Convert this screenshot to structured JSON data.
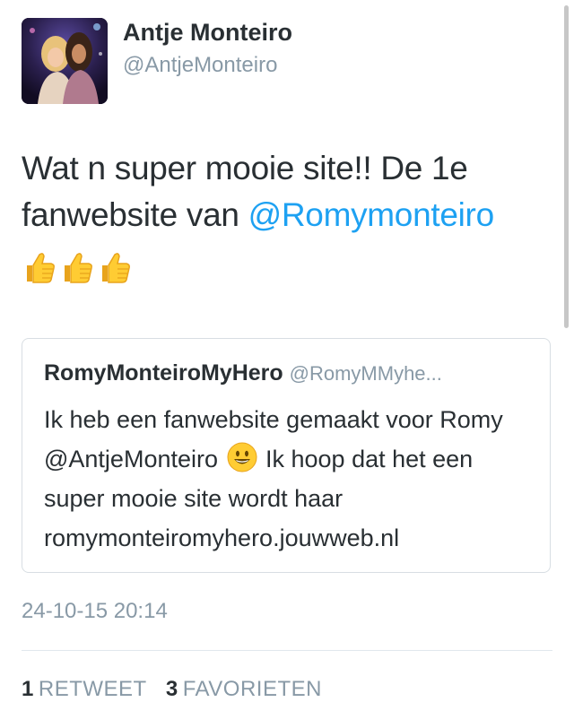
{
  "author": {
    "name": "Antje Monteiro",
    "handle": "@AntjeMonteiro"
  },
  "tweet": {
    "text_part1": "Wat n super mooie site!! De 1e fanwebsite van ",
    "mention": "@Romymonteiro",
    "emoji_icon": "thumbs-up-icon",
    "emoji_count": 3
  },
  "quoted_tweet": {
    "name": "RomyMonteiroMyHero",
    "handle": "@RomyMMyhe...",
    "text_part1": "Ik heb een fanwebsite gemaakt voor Romy @AntjeMonteiro ",
    "emoji_icon": "smiley-icon",
    "text_part2": " Ik hoop dat het een super mooie site wordt haar romymonteiromyhero.jouwweb.nl"
  },
  "timestamp": "24-10-15 20:14",
  "stats": {
    "retweets_count": "1",
    "retweets_label": "RETWEET",
    "favorites_count": "3",
    "favorites_label": "FAVORIETEN"
  },
  "colors": {
    "link": "#1da1f2",
    "text": "#292f33",
    "muted": "#8899a6",
    "border": "#d8dee3"
  }
}
